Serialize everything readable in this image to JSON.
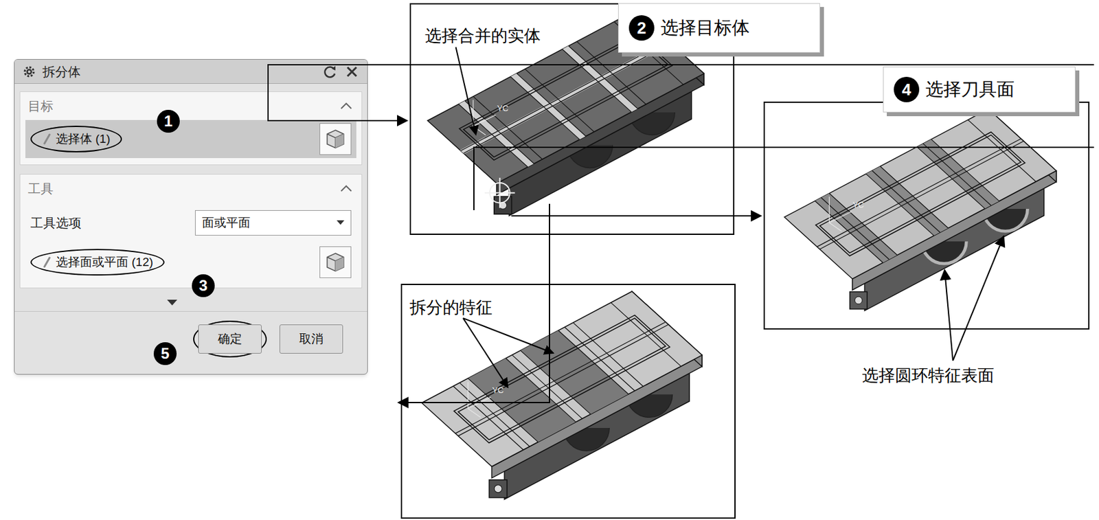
{
  "dialog": {
    "title": "拆分体",
    "sections": [
      {
        "title": "目标",
        "expanded": true,
        "rows": [
          {
            "kind": "selection",
            "label": "选择体 (1)",
            "selected": true
          }
        ]
      },
      {
        "title": "工具",
        "expanded": true,
        "rows": [
          {
            "kind": "dropdown",
            "label": "工具选项",
            "value": "面或平面"
          },
          {
            "kind": "selection",
            "label": "选择面或平面 (12)",
            "selected": false
          }
        ]
      }
    ],
    "buttons": [
      {
        "label": "确定",
        "highlighted": true
      },
      {
        "label": "取消",
        "highlighted": false
      }
    ]
  },
  "steps": [
    {
      "number": "1"
    },
    {
      "number": "2",
      "label": "选择目标体"
    },
    {
      "number": "3"
    },
    {
      "number": "4",
      "label": "选择刀具面"
    },
    {
      "number": "5"
    }
  ],
  "panels": [
    {
      "kind": "target",
      "caption": "选择合并的实体",
      "axis": "YC"
    },
    {
      "kind": "tool",
      "axis": "YC"
    },
    {
      "kind": "result",
      "caption": "拆分的特征",
      "axis": "YC"
    }
  ],
  "annotation": "选择圆环特征表面"
}
